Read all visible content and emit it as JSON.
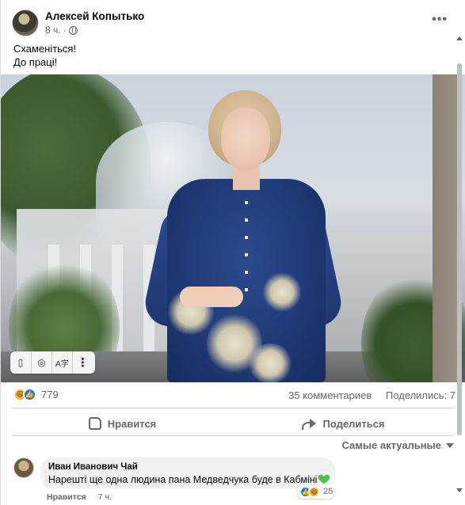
{
  "post": {
    "author": "Алексей Копытько",
    "time": "8 ч.",
    "privacy_icon": "globe-icon",
    "more_icon": "more-options-icon",
    "text_lines": [
      "Схаменіться!",
      "До праці!"
    ],
    "image_tools": [
      "bookmark-icon",
      "lens-icon",
      "translate-icon",
      "more-vertical-icon"
    ],
    "image_tool_glyphs": [
      "▯",
      "◎",
      "A字",
      "⋮"
    ]
  },
  "stats": {
    "reactions_count": "779",
    "reaction_icons": [
      "haha",
      "like"
    ],
    "comments": "35 комментариев",
    "shares": "Поделились: 7"
  },
  "actions": {
    "like": "Нравится",
    "share": "Поделиться"
  },
  "sort": {
    "label": "Самые актуальные"
  },
  "comment": {
    "author": "Иван Иванович Чай",
    "text": "Нарешті ще одна людина пана Медведчука буде в Кабміні",
    "reactions_count": "25",
    "like_label": "Нравится",
    "time": "7 ч."
  }
}
